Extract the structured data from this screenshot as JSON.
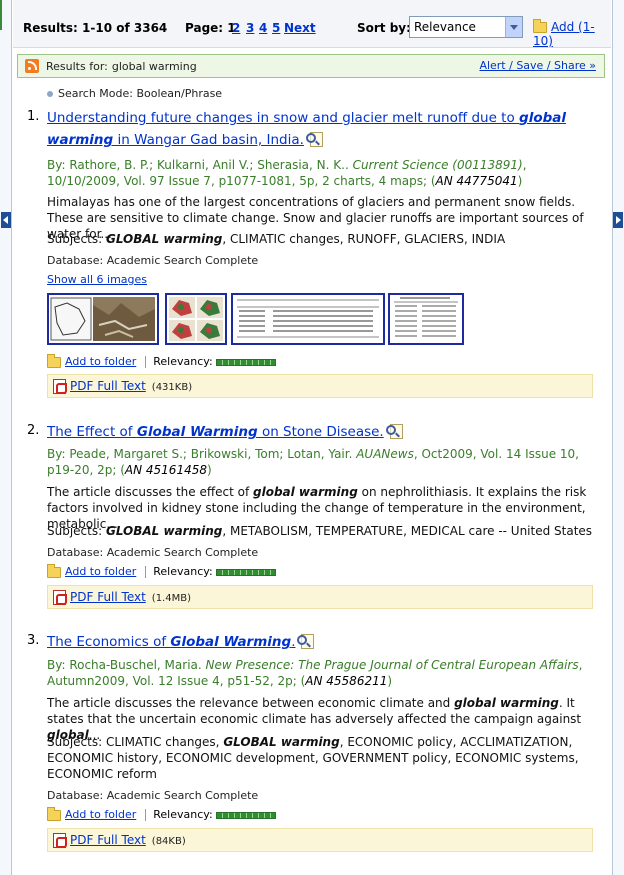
{
  "toolbar": {
    "results_label": "Results: 1-10 of 3364",
    "page_label": "Page: 1",
    "pages": [
      "2",
      "3",
      "4",
      "5"
    ],
    "next": "Next",
    "sort_label": "Sort by:",
    "sort_value": "Relevance",
    "add_label": "Add (1-10)"
  },
  "results_for": {
    "label": "Results for:",
    "query": "global warming",
    "alert": "Alert / Save / Share »"
  },
  "search_mode": "Search Mode: Boolean/Phrase",
  "records": [
    {
      "num": "1.",
      "title_pre": "Understanding future changes in snow and glacier melt runoff due to ",
      "title_em": "global warming",
      "title_post": " in Wangar Gad basin, India.",
      "authors": "By: Rathore, B. P.; Kulkarni, Anil V.; Sherasia, N. K.. ",
      "journal": "Current Science (00113891)",
      "details": ", 10/10/2009, Vol. 97 Issue 7, p1077-1081, 5p, 2 charts, 4 maps; (",
      "an": "AN 44775041",
      "details_end": ")",
      "abstract_pre": "Himalayas has one of the largest concentrations of glaciers and permanent snow fields. These are sensitive to climate change. Snow and glacier runoffs are important sources of water for...",
      "abstract_em": "",
      "abstract_mid": "",
      "abstract_em2": "",
      "abstract_end": "",
      "subjects_label": "Subjects: ",
      "subjects_em": "GLOBAL warming",
      "subjects_rest": ", CLIMATIC changes, RUNOFF, GLACIERS, INDIA",
      "database": "Database: Academic Search Complete",
      "show_images": "Show all 6 images",
      "add_folder": "Add to folder",
      "relevancy": "Relevancy:",
      "pdf_label": "PDF Full Text",
      "pdf_size": "(431KB)"
    },
    {
      "num": "2.",
      "title_pre": "The Effect of ",
      "title_em": "Global Warming",
      "title_post": " on Stone Disease.",
      "authors": "By: Peade, Margaret S.; Brikowski, Tom; Lotan, Yair. ",
      "journal": "AUANews",
      "details": ", Oct2009, Vol. 14 Issue 10, p19-20, 2p; (",
      "an": "AN 45161458",
      "details_end": ")",
      "abstract_pre": "The article discusses the effect of ",
      "abstract_em": "global warming",
      "abstract_mid": " on nephrolithiasis. It explains the risk factors involved in kidney stone including the change of temperature in the environment, metabolic...",
      "abstract_em2": "",
      "abstract_end": "",
      "subjects_label": "Subjects: ",
      "subjects_em": "GLOBAL warming",
      "subjects_rest": ", METABOLISM, TEMPERATURE, MEDICAL care -- United States",
      "database": "Database: Academic Search Complete",
      "add_folder": "Add to folder",
      "relevancy": "Relevancy:",
      "pdf_label": "PDF Full Text",
      "pdf_size": "(1.4MB)"
    },
    {
      "num": "3.",
      "title_pre": "The Economics of ",
      "title_em": "Global Warming",
      "title_post": ".",
      "authors": "By: Rocha-Buschel, Maria. ",
      "journal": "New Presence: The Prague Journal of Central European Affairs",
      "details": ", Autumn2009, Vol. 12 Issue 4, p51-52, 2p; (",
      "an": "AN 45586211",
      "details_end": ")",
      "abstract_pre": "The article discusses the relevance between economic climate and ",
      "abstract_em": "global warming",
      "abstract_mid": ". It states that the uncertain economic climate has adversely affected the campaign against ",
      "abstract_em2": "global",
      "abstract_end": "...",
      "subjects_label": "Subjects: CLIMATIC changes, ",
      "subjects_em": "GLOBAL warming",
      "subjects_rest": ", ECONOMIC policy, ACCLIMATIZATION, ECONOMIC history, ECONOMIC development, GOVERNMENT policy, ECONOMIC systems, ECONOMIC reform",
      "database": "Database: Academic Search Complete",
      "add_folder": "Add to folder",
      "relevancy": "Relevancy:",
      "pdf_label": "PDF Full Text",
      "pdf_size": "(84KB)"
    }
  ]
}
